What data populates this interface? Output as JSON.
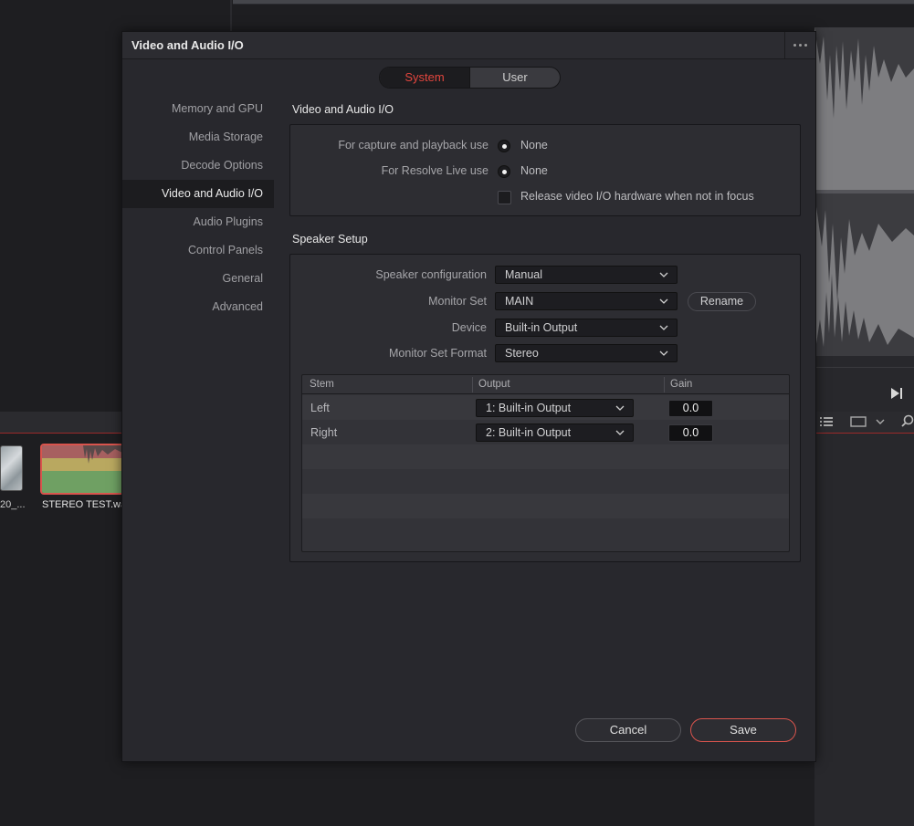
{
  "background": {
    "media_pool": {
      "clip1_label": "20_...",
      "clip2_label": "STEREO TEST.wav"
    }
  },
  "dialog": {
    "title": "Video and Audio I/O",
    "tabs": {
      "system": "System",
      "user": "User",
      "active": "system"
    },
    "sidebar": [
      {
        "label": "Memory and GPU"
      },
      {
        "label": "Media Storage"
      },
      {
        "label": "Decode Options"
      },
      {
        "label": "Video and Audio I/O",
        "active": true
      },
      {
        "label": "Audio Plugins"
      },
      {
        "label": "Control Panels"
      },
      {
        "label": "General"
      },
      {
        "label": "Advanced"
      }
    ],
    "video_io": {
      "section_title": "Video and Audio I/O",
      "capture_label": "For capture and playback use",
      "capture_value": "None",
      "live_label": "For Resolve Live use",
      "live_value": "None",
      "release_label": "Release video I/O hardware when not in focus",
      "release_checked": false
    },
    "speaker_setup": {
      "section_title": "Speaker Setup",
      "config_label": "Speaker configuration",
      "config_value": "Manual",
      "monitor_set_label": "Monitor Set",
      "monitor_set_value": "MAIN",
      "rename_label": "Rename",
      "device_label": "Device",
      "device_value": "Built-in Output",
      "format_label": "Monitor Set Format",
      "format_value": "Stereo",
      "table": {
        "headers": [
          "Stem",
          "Output",
          "Gain"
        ],
        "rows": [
          {
            "stem": "Left",
            "output": "1: Built-in Output",
            "gain": "0.0"
          },
          {
            "stem": "Right",
            "output": "2: Built-in Output",
            "gain": "0.0"
          }
        ]
      }
    },
    "footer": {
      "cancel": "Cancel",
      "save": "Save"
    },
    "colors": {
      "accent": "#e2463e",
      "dialog_bg": "#28282d",
      "panel_bg": "#2d2d32"
    }
  }
}
